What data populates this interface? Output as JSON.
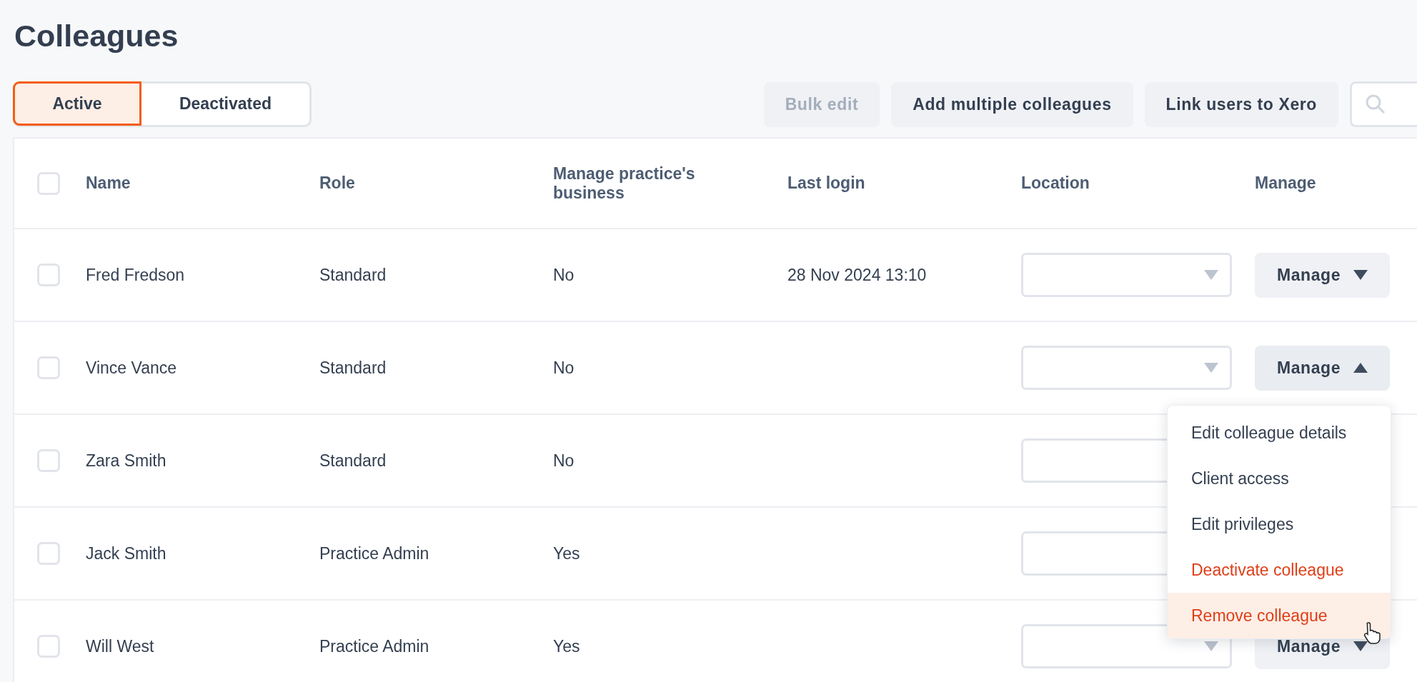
{
  "page": {
    "title": "Colleagues"
  },
  "tabs": [
    {
      "label": "Active",
      "selected": true
    },
    {
      "label": "Deactivated",
      "selected": false
    }
  ],
  "toolbar": {
    "buttons": [
      {
        "label": "Bulk edit",
        "disabled": true
      },
      {
        "label": "Add multiple colleagues",
        "disabled": false
      },
      {
        "label": "Link users to Xero",
        "disabled": false
      }
    ]
  },
  "table": {
    "select_all": {
      "checked": false
    },
    "columns": [
      "Name",
      "Role",
      "Manage practice's business",
      "Last login",
      "Location",
      "Manage"
    ],
    "rows": [
      {
        "checked": false,
        "name": "Fred Fredson",
        "role": "Standard",
        "manage_business": "No",
        "last_login": "28 Nov 2024 13:10",
        "manage_label": "Manage",
        "menu_open": false
      },
      {
        "checked": false,
        "name": "Vince Vance",
        "role": "Standard",
        "manage_business": "No",
        "manage_label": "Manage",
        "menu_open": true,
        "menu": [
          {
            "label": "Edit colleague details",
            "kind": "normal",
            "hovered": false
          },
          {
            "label": "Client access",
            "kind": "normal",
            "hovered": false
          },
          {
            "label": "Edit privileges",
            "kind": "normal",
            "hovered": false
          },
          {
            "label": "Deactivate colleague",
            "kind": "danger",
            "hovered": false
          },
          {
            "label": "Remove colleague",
            "kind": "danger",
            "hovered": true
          }
        ]
      },
      {
        "checked": false,
        "name": "Zara Smith",
        "role": "Standard",
        "manage_business": "No"
      },
      {
        "checked": false,
        "name": "Jack Smith",
        "role": "Practice Admin",
        "manage_business": "Yes"
      },
      {
        "checked": false,
        "name": "Will West",
        "role": "Practice Admin",
        "manage_business": "Yes",
        "manage_label": "Manage",
        "menu_open": false
      }
    ]
  }
}
